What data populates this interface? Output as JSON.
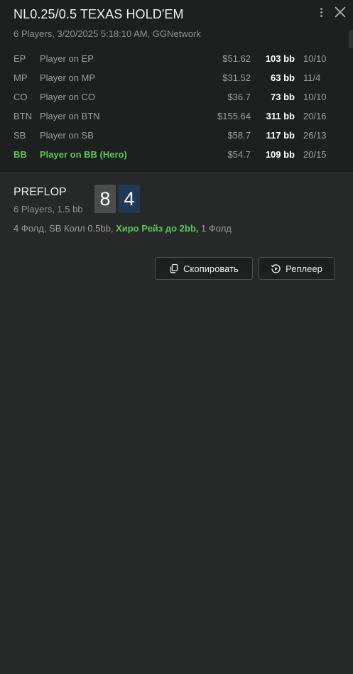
{
  "header": {
    "title": "NL0.25/0.5 TEXAS HOLD'EM",
    "subtitle": "6 Players, 3/20/2025 5:18:10 AM, GGNetwork",
    "icons": {
      "menu": "more-vertical-icon",
      "close": "close-icon"
    }
  },
  "players": [
    {
      "pos": "EP",
      "name": "Player on EP",
      "stack": "$51.62",
      "bb": "103 bb",
      "ratio": "10/10",
      "hero": false
    },
    {
      "pos": "MP",
      "name": "Player on MP",
      "stack": "$31.52",
      "bb": "63 bb",
      "ratio": "11/4",
      "hero": false
    },
    {
      "pos": "CO",
      "name": "Player on CO",
      "stack": "$36.7",
      "bb": "73 bb",
      "ratio": "10/10",
      "hero": false
    },
    {
      "pos": "BTN",
      "name": "Player on BTN",
      "stack": "$155.64",
      "bb": "311 bb",
      "ratio": "20/16",
      "hero": false
    },
    {
      "pos": "SB",
      "name": "Player on SB",
      "stack": "$58.7",
      "bb": "117 bb",
      "ratio": "26/13",
      "hero": false
    },
    {
      "pos": "BB",
      "name": "Player on BB (Hero)",
      "stack": "$54.7",
      "bb": "109 bb",
      "ratio": "20/15",
      "hero": true
    }
  ],
  "street": {
    "name": "PREFLOP",
    "info": "6 Players, 1.5 bb",
    "cards": [
      "8",
      "4"
    ],
    "actions": {
      "before": "4 Фолд, SB Колл 0.5bb, ",
      "hero": "Хиро Рейз до 2bb,",
      "after": " 1 Фолд"
    }
  },
  "buttons": {
    "copy": "Скопировать",
    "replay": "Реплеер"
  },
  "colors": {
    "background": "#262927",
    "header_bg": "#1d201e",
    "hero_green": "#5cc35c",
    "card_dark": "#4a4d4c",
    "card_blue": "#1f3a57"
  }
}
